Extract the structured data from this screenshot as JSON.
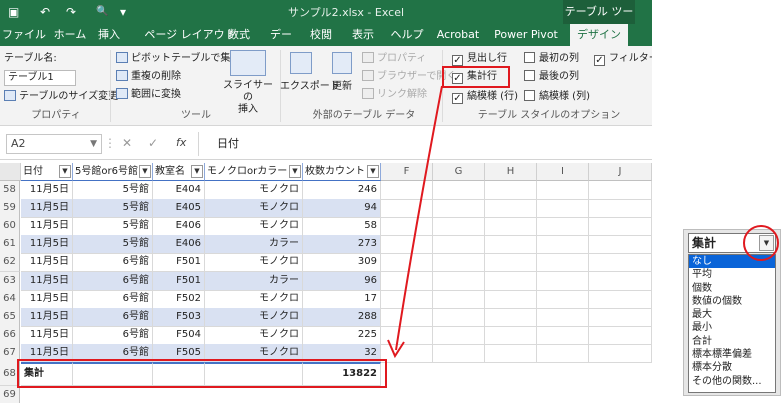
{
  "titlebar": {
    "title": "サンプル2.xlsx  -  Excel",
    "context_tab": "テーブル ツール",
    "save_glyph": "▣",
    "undo_glyph": "↶",
    "redo_glyph": "↷",
    "preview_glyph": "🔍",
    "more_glyph": "▾"
  },
  "tabs": [
    "ファイル",
    "ホーム",
    "挿入",
    "ページ レイアウト",
    "数式",
    "データ",
    "校閲",
    "表示",
    "ヘルプ",
    "Acrobat",
    "Power Pivot",
    "デザイン"
  ],
  "ribbon": {
    "properties": {
      "table_name_label": "テーブル名:",
      "table_name_value": "テーブル1",
      "resize_label": "テーブルのサイズ変更",
      "group_label": "プロパティ"
    },
    "tools": {
      "pivot": "ピボットテーブルで集計",
      "remove_dup": "重複の削除",
      "convert": "範囲に変換",
      "slicer": "スライサーの\n挿入",
      "group_label": "ツール"
    },
    "external": {
      "export": "エクスポート",
      "refresh": "更新",
      "properties": "プロパティ",
      "open_browser": "ブラウザーで開く",
      "unlink": "リンク解除",
      "group_label": "外部のテーブル データ"
    },
    "style_options": {
      "header_row": "見出し行",
      "total_row": "集計行",
      "banded_rows": "縞模様 (行)",
      "first_col": "最初の列",
      "last_col": "最後の列",
      "banded_cols": "縞模様 (列)",
      "filter_btn": "フィルター ボ",
      "group_label": "テーブル スタイルのオプション"
    }
  },
  "formulabar": {
    "namebox": "A2",
    "fx": "fx",
    "cancel": "✕",
    "enter": "✓",
    "value": "日付"
  },
  "grid": {
    "col_letters": [
      "F",
      "G",
      "H",
      "I",
      "J"
    ],
    "headers": [
      "日付",
      "5号館or6号館",
      "教室名",
      "モノクロorカラー",
      "枚数カウント"
    ],
    "rows": [
      {
        "num": "58",
        "cells": [
          "11月5日",
          "5号館",
          "E404",
          "モノクロ",
          "246"
        ]
      },
      {
        "num": "59",
        "cells": [
          "11月5日",
          "5号館",
          "E405",
          "モノクロ",
          "94"
        ]
      },
      {
        "num": "60",
        "cells": [
          "11月5日",
          "5号館",
          "E406",
          "モノクロ",
          "58"
        ]
      },
      {
        "num": "61",
        "cells": [
          "11月5日",
          "5号館",
          "E406",
          "カラー",
          "273"
        ]
      },
      {
        "num": "62",
        "cells": [
          "11月5日",
          "6号館",
          "F501",
          "モノクロ",
          "309"
        ]
      },
      {
        "num": "63",
        "cells": [
          "11月5日",
          "6号館",
          "F501",
          "カラー",
          "96"
        ]
      },
      {
        "num": "64",
        "cells": [
          "11月5日",
          "6号館",
          "F502",
          "モノクロ",
          "17"
        ]
      },
      {
        "num": "65",
        "cells": [
          "11月5日",
          "6号館",
          "F503",
          "モノクロ",
          "288"
        ]
      },
      {
        "num": "66",
        "cells": [
          "11月5日",
          "6号館",
          "F504",
          "モノクロ",
          "225"
        ]
      },
      {
        "num": "67",
        "cells": [
          "11月5日",
          "6号館",
          "F505",
          "モノクロ",
          "32"
        ]
      }
    ],
    "total_row": {
      "num": "68",
      "label": "集計",
      "value": "13822"
    },
    "empty_row": {
      "num": "69"
    }
  },
  "dropdown": {
    "value": "集計",
    "items": [
      "なし",
      "平均",
      "個数",
      "数値の個数",
      "最大",
      "最小",
      "合計",
      "標本標準偏差",
      "標本分散",
      "その他の関数..."
    ],
    "selected_index": 0
  }
}
